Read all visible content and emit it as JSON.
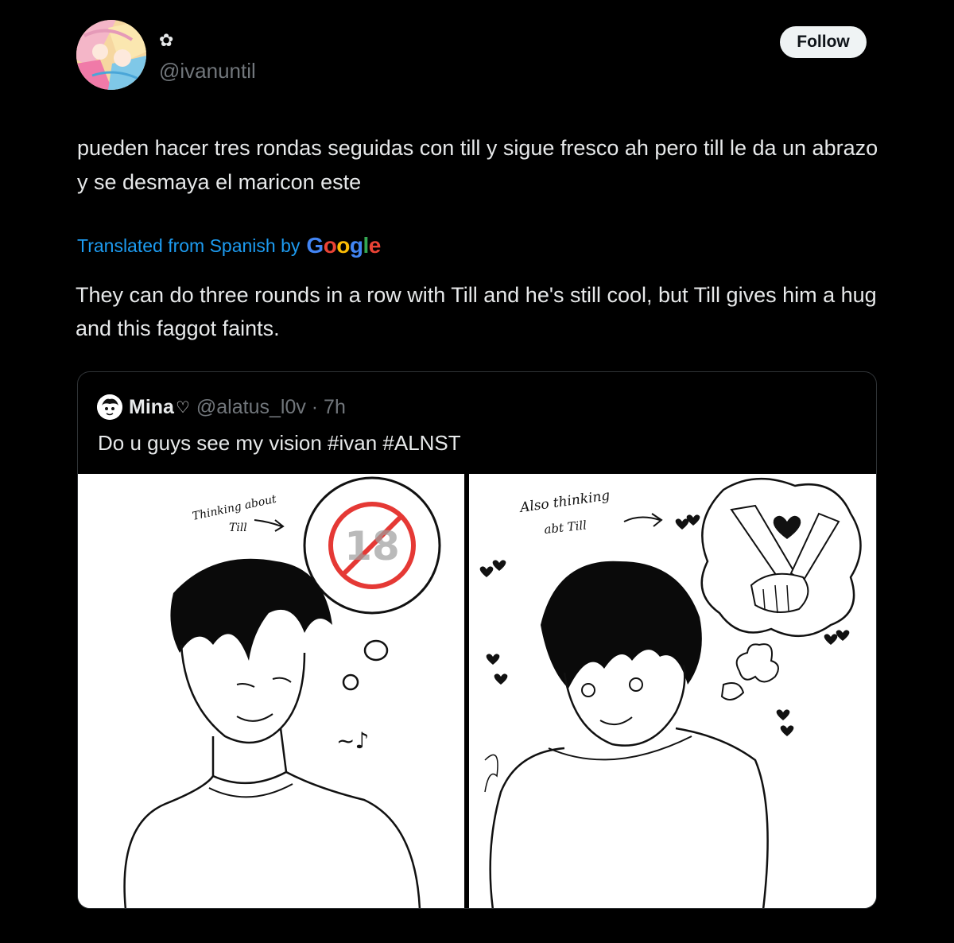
{
  "post": {
    "display_name": "✿",
    "handle": "@ivanuntil",
    "follow_label": "Follow",
    "text": "pueden hacer tres rondas seguidas con till y sigue fresco ah pero till le da un abrazo y se desmaya el maricon este",
    "translated_label": "Translated from Spanish by",
    "translation_provider": "Google",
    "translation": "They can do three rounds in a row with Till and he's still cool, but Till gives him a hug and this faggot faints."
  },
  "quote": {
    "name": "Mina",
    "heart": "♡",
    "handle_time": "@alatus_l0v · 7h",
    "text": "Do u guys see my vision #ivan #ALNST",
    "left_panel": {
      "note_line1": "Thinking about",
      "note_line2": "Till",
      "badge": "18",
      "music": "~♪"
    },
    "right_panel": {
      "note_line1": "Also thinking",
      "note_line2": "abt Till"
    }
  },
  "colors": {
    "background": "#000000",
    "text": "#e7e9ea",
    "muted": "#71767b",
    "link": "#1d9bf0",
    "follow_bg": "#eff3f4"
  }
}
